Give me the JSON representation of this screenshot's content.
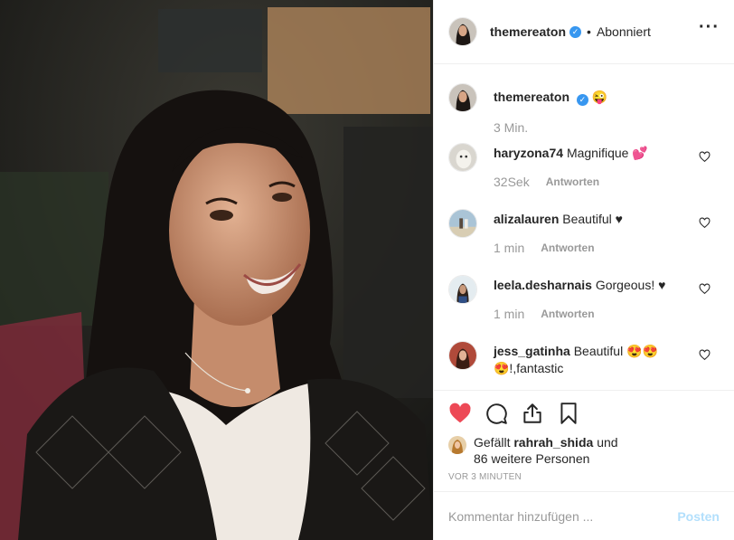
{
  "post": {
    "author": "themereaton",
    "follow_status": "Abonniert",
    "separator": "•",
    "more": "···",
    "caption_text": "😜",
    "caption_time": "3 Min."
  },
  "comments": [
    {
      "user": "haryzona74",
      "text": "Magnifique 💕",
      "time": "32Sek",
      "reply": "Antworten"
    },
    {
      "user": "alizalauren",
      "text": "Beautiful ♥",
      "time": "1 min",
      "reply": "Antworten"
    },
    {
      "user": "leela.desharnais",
      "text": "Gorgeous! ♥",
      "time": "1 min",
      "reply": "Antworten"
    },
    {
      "user": "jess_gatinha",
      "text": "Beautiful 😍😍 😍!,fantastic",
      "time": "",
      "reply": ""
    }
  ],
  "likes": {
    "prefix": "Gefällt",
    "user": "rahrah_shida",
    "suffix": "und",
    "others": "86 weitere Personen"
  },
  "timestamp": "VOR 3 MINUTEN",
  "comment_box": {
    "placeholder": "Kommentar hinzufügen ...",
    "post_label": "Posten"
  },
  "icons": {
    "like": "heart-filled-icon",
    "comment": "comment-icon",
    "share": "share-icon",
    "save": "bookmark-icon",
    "verified": "verified-icon",
    "comment_like": "heart-outline-icon"
  },
  "colors": {
    "like_red": "#ed4956",
    "verified_blue": "#3897f0",
    "post_disabled": "#b2dffc",
    "muted": "#999999"
  }
}
